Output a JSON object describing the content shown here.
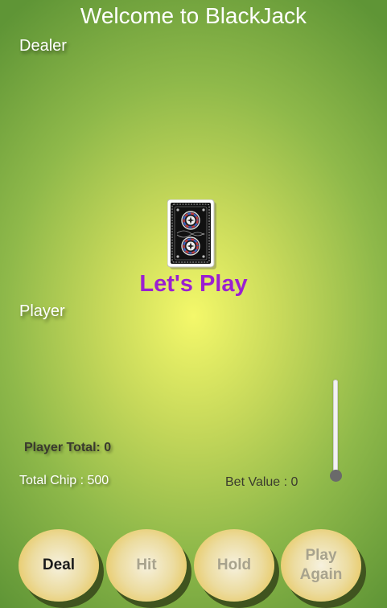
{
  "title": "Welcome to BlackJack",
  "dealer": {
    "label": "Dealer"
  },
  "player": {
    "label": "Player",
    "total_text": "Player Total: 0"
  },
  "deck": {
    "icon": "card-back-icon"
  },
  "status": {
    "message": "Let's Play",
    "color": "#9b1fd1"
  },
  "chips": {
    "total_text": "Total Chip : 500",
    "bet_text": "Bet Value : 0",
    "bet_fraction": 0
  },
  "buttons": {
    "deal": "Deal",
    "hit": "Hit",
    "hold": "Hold",
    "play_again_line1": "Play",
    "play_again_line2": "Again"
  },
  "colors": {
    "table_center": "#f4f86a",
    "table_edge": "#5f9536",
    "button_face": "#e6bf45",
    "button_shadow": "#40541f"
  }
}
